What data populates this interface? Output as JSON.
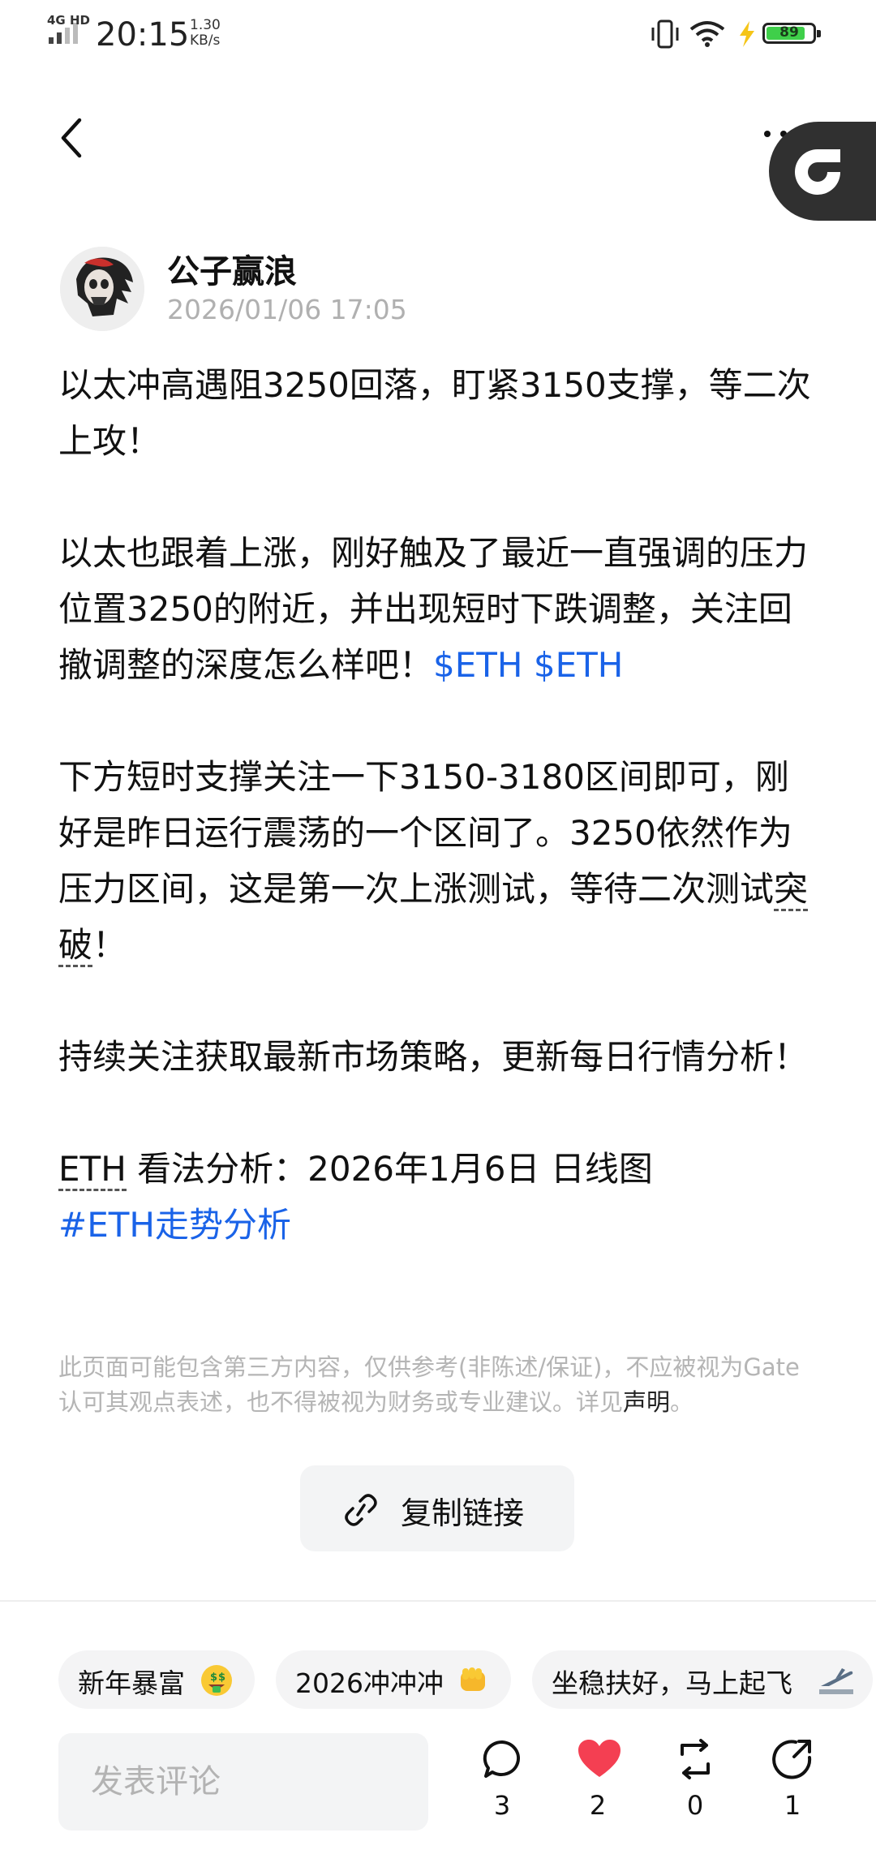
{
  "status_bar": {
    "network": "4G HD",
    "time": "20:15",
    "speed_value": "1.30",
    "speed_unit": "KB/s",
    "battery": "89"
  },
  "post": {
    "author": "公子赢浪",
    "timestamp": "2026/01/06 17:05",
    "paragraph1": "以太冲高遇阻3250回落，盯紧3150支撑，等二次上攻！",
    "paragraph2": "以太也跟着上涨，刚好触及了最近一直强调的压力位置3250的附近，并出现短时下跌调整，关注回撤调整的深度怎么样吧！",
    "tag_eth_1": "$ETH",
    "tag_eth_2": "$ETH",
    "paragraph3_a": "下方短时支撑关注一下3150-3180区间即可，刚好是昨日运行震荡的一个区间了。3250依然作为压力区间，这是第一次上涨测试，等待二次测试",
    "paragraph3_b": "突破",
    "paragraph3_c": "！",
    "paragraph4": "持续关注获取最新市场策略，更新每日行情分析！",
    "eth_term": "ETH",
    "paragraph5": " 看法分析：2026年1月6日 日线图",
    "hashtag": "#ETH走势分析"
  },
  "disclaimer": {
    "text": "此页面可能包含第三方内容，仅供参考(非陈述/保证)，不应被视为Gate认可其观点表述，也不得被视为财务或专业建议。详见",
    "link": "声明",
    "end": "。"
  },
  "copy_link": {
    "label": "复制链接"
  },
  "chips": [
    {
      "label": "新年暴富"
    },
    {
      "label": "2026冲冲冲"
    },
    {
      "label": "坐稳扶好，马上起飞"
    }
  ],
  "comment": {
    "placeholder": "发表评论"
  },
  "actions": {
    "comment_count": "3",
    "like_count": "2",
    "repost_count": "0",
    "share_count": "1"
  },
  "colors": {
    "link_blue": "#1a63e8",
    "like_red": "#f43f52",
    "battery_green": "#3fcf4a"
  }
}
